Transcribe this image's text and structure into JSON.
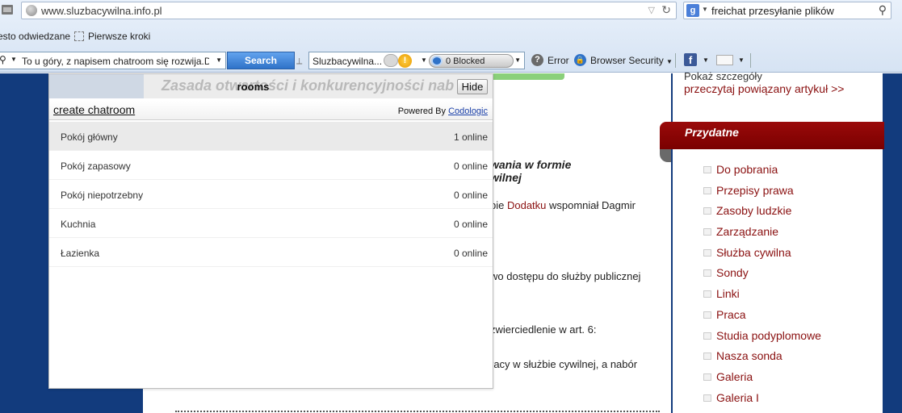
{
  "browser": {
    "url": "www.sluzbacywilna.info.pl",
    "search_query": "freichat przesyłanie plików",
    "search_engine_letter": "g",
    "bookmarks": [
      "esto odwiedzane",
      "Pierwsze kroki"
    ]
  },
  "toolbar": {
    "search_text": "To u góry, z napisem chatroom się rozwija.D",
    "search_label": "Search",
    "site_name": "Sluzbacywilna...",
    "warn_glyph": "!",
    "blocked_label": "0 Blocked",
    "help_glyph": "?",
    "error_label": "Error",
    "browser_security_label": "Browser Security",
    "facebook_letter": "f"
  },
  "content": {
    "ghost_heading": "Zasada otwartości i konkurencyjności nab",
    "heading_lines": [
      "wania w formie",
      "wilnej"
    ],
    "para1_pre": "bie ",
    "para1_link": "Dodatku",
    "para1_post": " wspomniał Dagmir",
    "para2": "wo dostępu do służby publicznej",
    "para3": "zwierciedlenie w art. 6:",
    "para4": "racy w służbie cywilnej, a nabór"
  },
  "sidebar": {
    "top_text": "Pokaż szczegóły",
    "related_link": "przeczytaj powiązany artykuł >>",
    "section_title": "Przydatne",
    "links": [
      "Do pobrania",
      "Przepisy prawa",
      "Zasoby ludzkie",
      "Zarządzanie",
      "Służba cywilna",
      "Sondy",
      "Linki",
      "Praca",
      "Studia podyplomowe",
      "Nasza sonda",
      "Galeria",
      "Galeria I"
    ]
  },
  "chat": {
    "title": "rooms",
    "hide_label": "Hide",
    "create_label": "create chatroom",
    "powered_prefix": "Powered By ",
    "powered_link": "Codologic",
    "rooms": [
      {
        "name": "Pokój główny",
        "online": "1 online"
      },
      {
        "name": "Pokój zapasowy",
        "online": "0 online"
      },
      {
        "name": "Pokój niepotrzebny",
        "online": "0 online"
      },
      {
        "name": "Kuchnia",
        "online": "0 online"
      },
      {
        "name": "Łazienka",
        "online": "0 online"
      }
    ]
  },
  "colors": {
    "page_bg": "#123b7d",
    "accent_red": "#8a1010",
    "search_button": "#2f72c8"
  }
}
